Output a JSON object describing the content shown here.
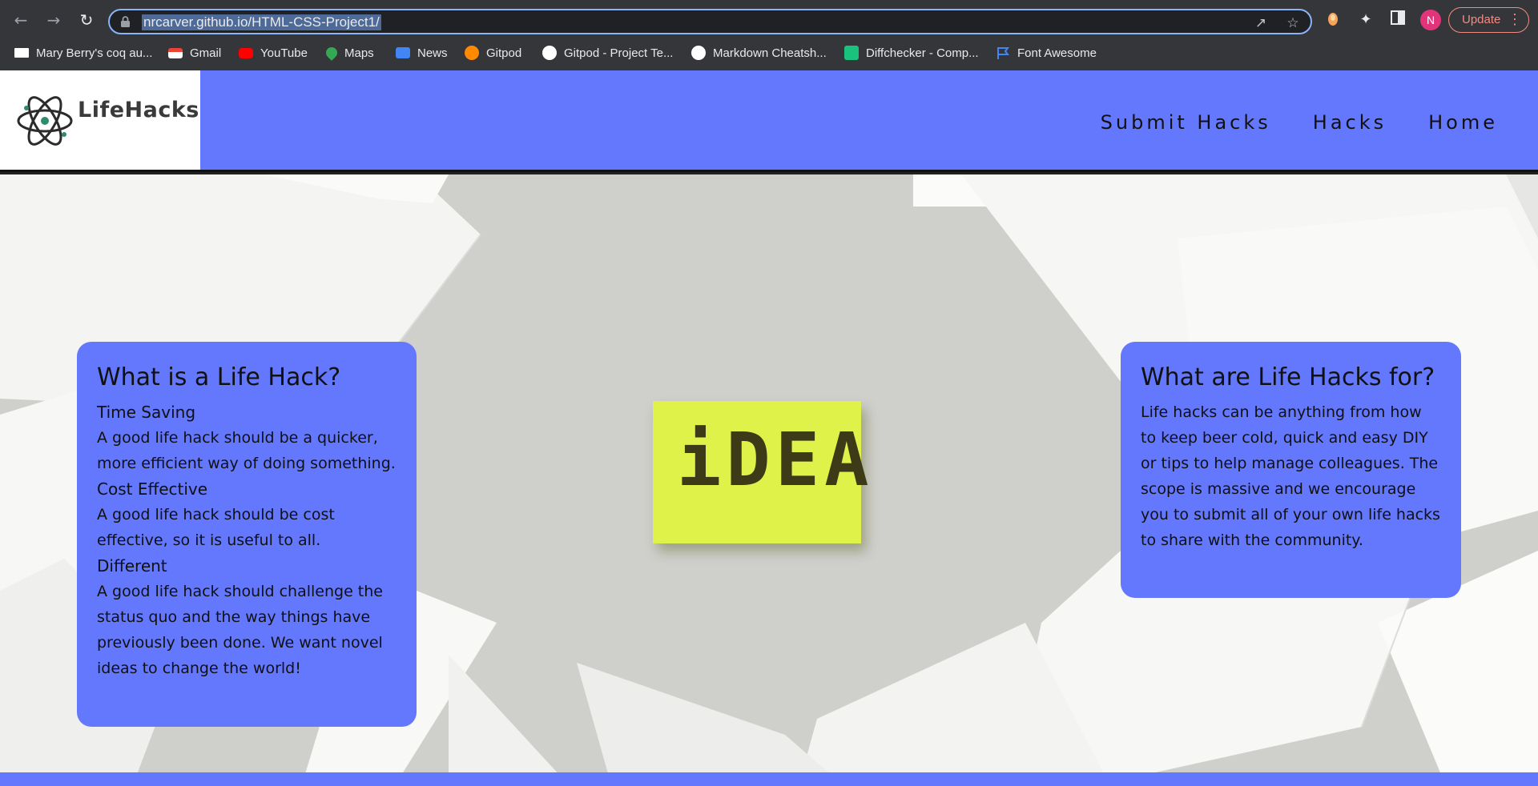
{
  "browser": {
    "url": "nrcarver.github.io/HTML-CSS-Project1/",
    "avatar_initial": "N",
    "update_label": "Update",
    "bookmarks": [
      {
        "label": "Mary Berry's coq au...",
        "icon": "bookmark-favicon",
        "color": "#ffffff"
      },
      {
        "label": "Gmail",
        "icon": "gmail-icon",
        "color": "#ea4335"
      },
      {
        "label": "YouTube",
        "icon": "youtube-icon",
        "color": "#ff0000"
      },
      {
        "label": "Maps",
        "icon": "maps-icon",
        "color": "#34a853"
      },
      {
        "label": "News",
        "icon": "news-icon",
        "color": "#4285f4"
      },
      {
        "label": "Gitpod",
        "icon": "gitpod-icon",
        "color": "#ff8a00"
      },
      {
        "label": "Gitpod - Project Te...",
        "icon": "github-icon",
        "color": "#ffffff"
      },
      {
        "label": "Markdown Cheatsh...",
        "icon": "github-icon",
        "color": "#ffffff"
      },
      {
        "label": "Diffchecker - Comp...",
        "icon": "diffchecker-icon",
        "color": "#19c37d"
      },
      {
        "label": "Font Awesome",
        "icon": "flag-icon",
        "color": "#4285f4"
      }
    ]
  },
  "site": {
    "logo_text": "LifeHacks",
    "nav": [
      "Submit Hacks",
      "Hacks",
      "Home"
    ],
    "accent_color": "#6478fd"
  },
  "hero": {
    "sticky_note": "iDEA",
    "left_card": {
      "title": "What is a Life Hack?",
      "items": [
        {
          "heading": "Time Saving",
          "text": "A good life hack should be a quicker, more efficient way of doing something."
        },
        {
          "heading": "Cost Effective",
          "text": "A good life hack should be cost effective, so it is useful to all."
        },
        {
          "heading": "Different",
          "text": "A good life hack should challenge the status quo and the way things have previously been done. We want novel ideas to change the world!"
        }
      ]
    },
    "right_card": {
      "title": "What are Life Hacks for?",
      "text": "Life hacks can be anything from how to keep beer cold, quick and easy DIY or tips to help manage colleagues. The scope is massive and we encourage you to submit all of your own life hacks to share with the community."
    }
  }
}
